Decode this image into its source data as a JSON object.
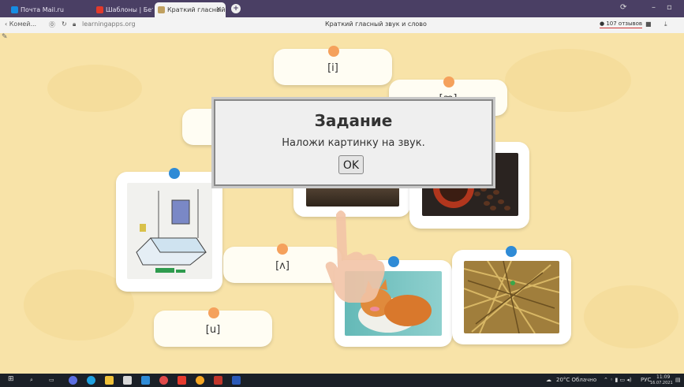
{
  "browser": {
    "tabs": [
      {
        "label": "Почта Mail.ru",
        "color": "#168de2"
      },
      {
        "label": "Шаблоны | Бетерусные",
        "color": "#e23a2b"
      },
      {
        "label": "Краткий гласный звук",
        "color": "#c0a060"
      }
    ],
    "new_tab": "+",
    "back": "‹ Комей...",
    "url": "learningapps.org",
    "page_title": "Краткий гласный звук и слово",
    "reviews": "● 107 отзывов"
  },
  "exercise": {
    "cards": {
      "i": "[i]",
      "ae": "[æ]",
      "wedge": "[ʌ]",
      "u": "[u]"
    }
  },
  "modal": {
    "title": "Задание",
    "text": "Наложи картинку на звук.",
    "ok": "OK"
  },
  "taskbar": {
    "weather": "20°C Облачно",
    "lang": "РУС",
    "time": "11:09",
    "date": "16.07.2021"
  },
  "colors": {
    "accent_orange": "#f5a15c",
    "accent_blue": "#2f8bd6",
    "background": "#f8e3a8"
  }
}
